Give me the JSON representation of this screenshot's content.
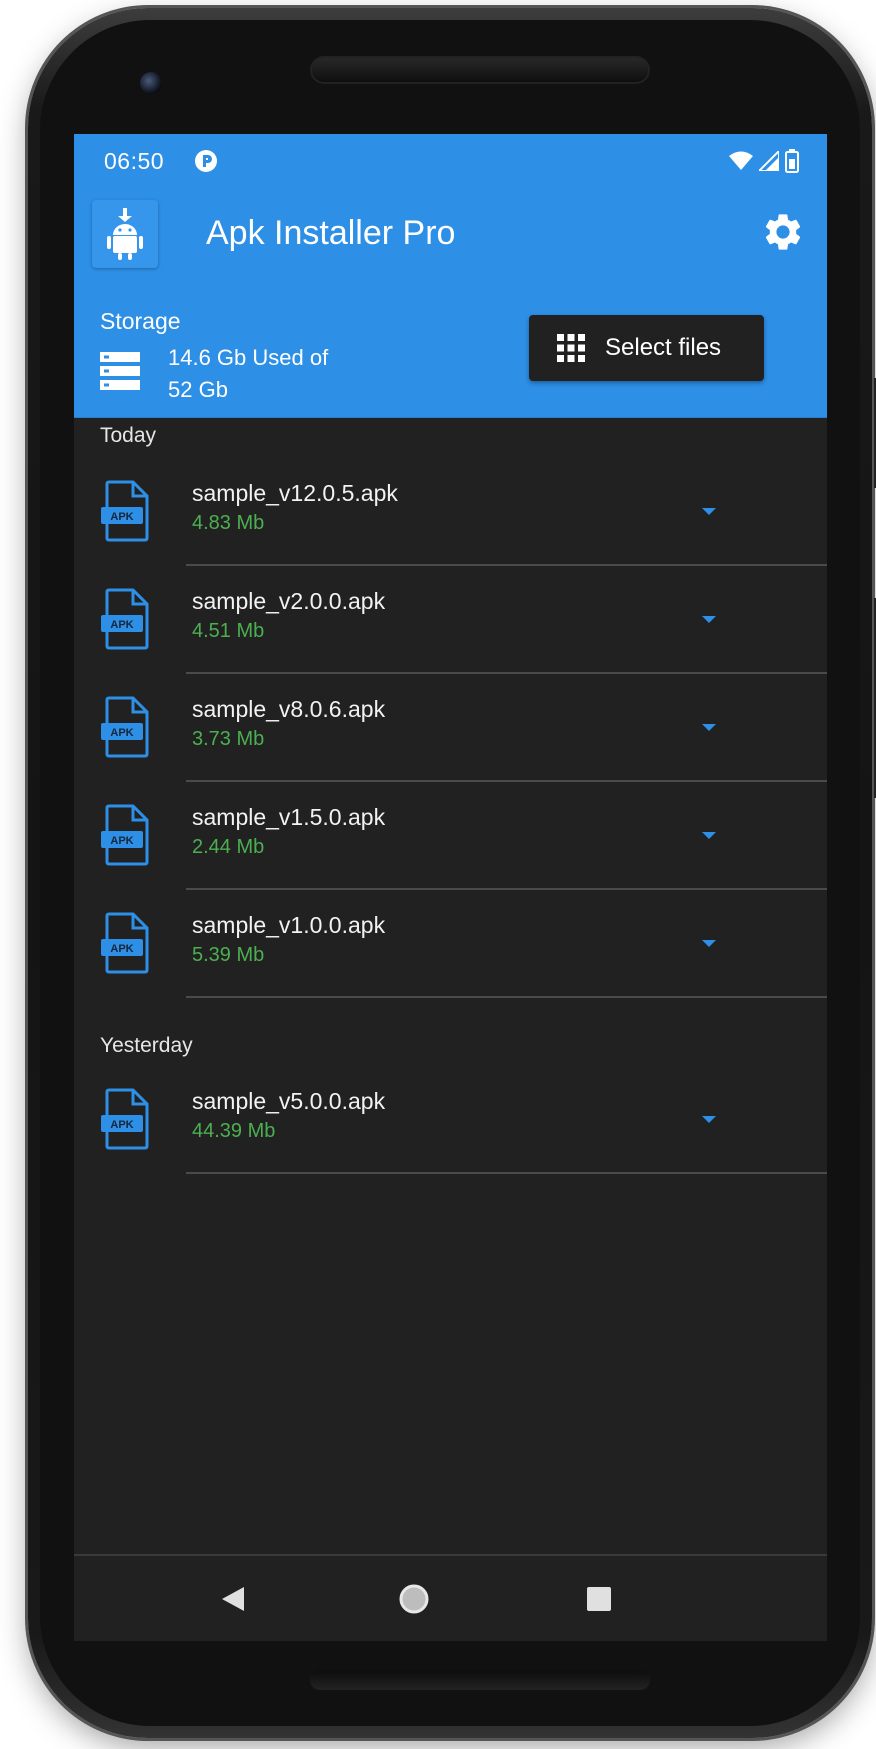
{
  "status_bar": {
    "time": "06:50",
    "icons": [
      "app-notification-icon",
      "wifi-icon",
      "cell-signal-icon",
      "battery-icon"
    ]
  },
  "app_bar": {
    "title": "Apk Installer Pro",
    "logo_icon": "android-download-icon",
    "settings_icon": "gear-icon"
  },
  "storage": {
    "title": "Storage",
    "icon": "storage-icon",
    "used_text": "14.6 Gb Used of",
    "total_text": "52 Gb",
    "select_files_label": "Select files",
    "select_files_icon": "grid-icon"
  },
  "sections": [
    {
      "header": "Today",
      "files": [
        {
          "name": "sample_v12.0.5.apk",
          "size": "4.83 Mb"
        },
        {
          "name": "sample_v2.0.0.apk",
          "size": "4.51 Mb"
        },
        {
          "name": "sample_v8.0.6.apk",
          "size": "3.73 Mb"
        },
        {
          "name": "sample_v1.5.0.apk",
          "size": "2.44 Mb"
        },
        {
          "name": "sample_v1.0.0.apk",
          "size": "5.39 Mb"
        }
      ]
    },
    {
      "header": "Yesterday",
      "files": [
        {
          "name": "sample_v5.0.0.apk",
          "size": "44.39 Mb"
        }
      ]
    }
  ],
  "file_icon_label": "APK",
  "nav_bar": {
    "buttons": [
      "back-icon",
      "home-icon",
      "recent-apps-icon"
    ]
  },
  "colors": {
    "primary": "#2d8fe6",
    "background": "#212121",
    "size_text": "#4caf50",
    "accent_icon": "#2d8fe6"
  }
}
